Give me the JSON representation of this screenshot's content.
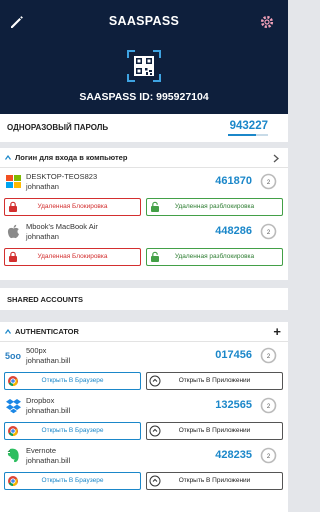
{
  "appbar": {
    "title": "SAASPASS",
    "left_icon": "pencil-icon",
    "right_icon": "gear-icon"
  },
  "hero": {
    "qr_icon": "qr-code-icon",
    "saaspass_id": "SAASPASS ID: 995927104"
  },
  "otp": {
    "label": "ОДНОРАЗОВЫЙ ПАРОЛЬ",
    "code": "943227",
    "progress": 0.7
  },
  "computer_login": {
    "header": "Логин для входа в компьютер",
    "entries": [
      {
        "name": "DESKTOP-TEOS823",
        "user": "johnathan",
        "code": "461870",
        "timer": "2",
        "logo": "windows-logo-icon"
      },
      {
        "name": "Mbook's MacBook Air",
        "user": "johnathan",
        "code": "448286",
        "timer": "2",
        "logo": "apple-logo-icon"
      }
    ],
    "lock_label": "Удаленная Блокировка",
    "unlock_label": "Удаленная разблокировка"
  },
  "shared_accounts": {
    "label": "SHARED ACCOUNTS"
  },
  "authenticator": {
    "header": "AUTHENTICATOR",
    "entries": [
      {
        "name": "500px",
        "user": "johnathan.bill",
        "code": "017456",
        "timer": "2",
        "logo": "500px-logo-icon"
      },
      {
        "name": "Dropbox",
        "user": "johnathan.bill",
        "code": "132565",
        "timer": "2",
        "logo": "dropbox-logo-icon"
      },
      {
        "name": "Evernote",
        "user": "johnathan.bill",
        "code": "428235",
        "timer": "2",
        "logo": "evernote-logo-icon"
      }
    ],
    "browser_label": "Открыть В Браузере",
    "app_label": "Открыть В Приложении"
  },
  "colors": {
    "navy": "#0e1f3c",
    "accent": "#1b87c9",
    "red": "#d32f2f",
    "green": "#43a047"
  }
}
